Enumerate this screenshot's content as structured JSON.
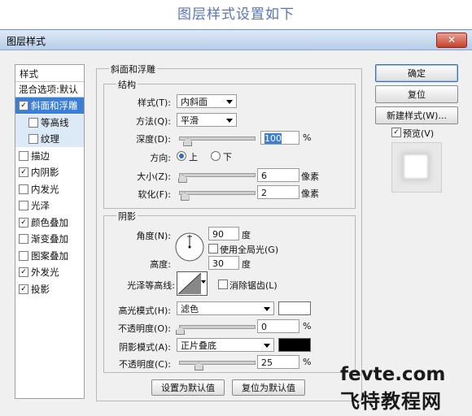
{
  "caption": "图层样式设置如下",
  "window": {
    "title": "图层样式",
    "close_glyph": "✕"
  },
  "left_panel": {
    "header": "样式",
    "blend_options": "混合选项:默认",
    "items": [
      {
        "label": "斜面和浮雕",
        "checked": true,
        "selected": true,
        "indent": 0
      },
      {
        "label": "等高线",
        "checked": false,
        "selected": false,
        "indent": 1
      },
      {
        "label": "纹理",
        "checked": false,
        "selected": false,
        "indent": 1
      },
      {
        "label": "描边",
        "checked": false,
        "selected": false,
        "indent": 0
      },
      {
        "label": "内阴影",
        "checked": true,
        "selected": false,
        "indent": 0
      },
      {
        "label": "内发光",
        "checked": false,
        "selected": false,
        "indent": 0
      },
      {
        "label": "光泽",
        "checked": false,
        "selected": false,
        "indent": 0
      },
      {
        "label": "颜色叠加",
        "checked": true,
        "selected": false,
        "indent": 0
      },
      {
        "label": "渐变叠加",
        "checked": false,
        "selected": false,
        "indent": 0
      },
      {
        "label": "图案叠加",
        "checked": false,
        "selected": false,
        "indent": 0
      },
      {
        "label": "外发光",
        "checked": true,
        "selected": false,
        "indent": 0
      },
      {
        "label": "投影",
        "checked": true,
        "selected": false,
        "indent": 0
      }
    ]
  },
  "bevel": {
    "group_title": "斜面和浮雕",
    "structure": {
      "title": "结构",
      "style_label": "样式(T):",
      "style_value": "内斜面",
      "technique_label": "方法(Q):",
      "technique_value": "平滑",
      "depth_label": "深度(D):",
      "depth_value": "100",
      "depth_unit": "%",
      "depth_level": 0.1,
      "direction_label": "方向:",
      "direction_up": "上",
      "direction_down": "下",
      "direction_selected": "up",
      "size_label": "大小(Z):",
      "size_value": "6",
      "size_unit": "像素",
      "size_level": 0.03,
      "soften_label": "软化(F):",
      "soften_value": "2",
      "soften_unit": "像素",
      "soften_level": 0.06
    },
    "shading": {
      "title": "阴影",
      "angle_label": "角度(N):",
      "angle_value": "90",
      "angle_unit": "度",
      "global_light_label": "使用全局光(G)",
      "global_light_checked": false,
      "altitude_label": "高度:",
      "altitude_value": "30",
      "altitude_unit": "度",
      "gloss_label": "光泽等高线:",
      "anti_alias_label": "消除锯齿(L)",
      "anti_alias_checked": false,
      "highlight_mode_label": "高光模式(H):",
      "highlight_mode_value": "滤色",
      "highlight_color": "#ffffff",
      "highlight_opacity_label": "不透明度(O):",
      "highlight_opacity_value": "0",
      "highlight_opacity_unit": "%",
      "highlight_opacity_level": 0.0,
      "shadow_mode_label": "阴影模式(A):",
      "shadow_mode_value": "正片叠底",
      "shadow_color": "#000000",
      "shadow_opacity_label": "不透明度(C):",
      "shadow_opacity_value": "25",
      "shadow_opacity_unit": "%",
      "shadow_opacity_level": 0.25
    },
    "make_default": "设置为默认值",
    "reset_default": "复位为默认值"
  },
  "right": {
    "ok": "确定",
    "reset": "复位",
    "new_style": "新建样式(W)...",
    "preview_label": "预览(V)",
    "preview_checked": true
  },
  "watermark": {
    "line1": "fevte.com",
    "line2": "飞特教程网"
  },
  "colors": {
    "accent": "#3a7fd5",
    "caption": "#5a74b8"
  }
}
